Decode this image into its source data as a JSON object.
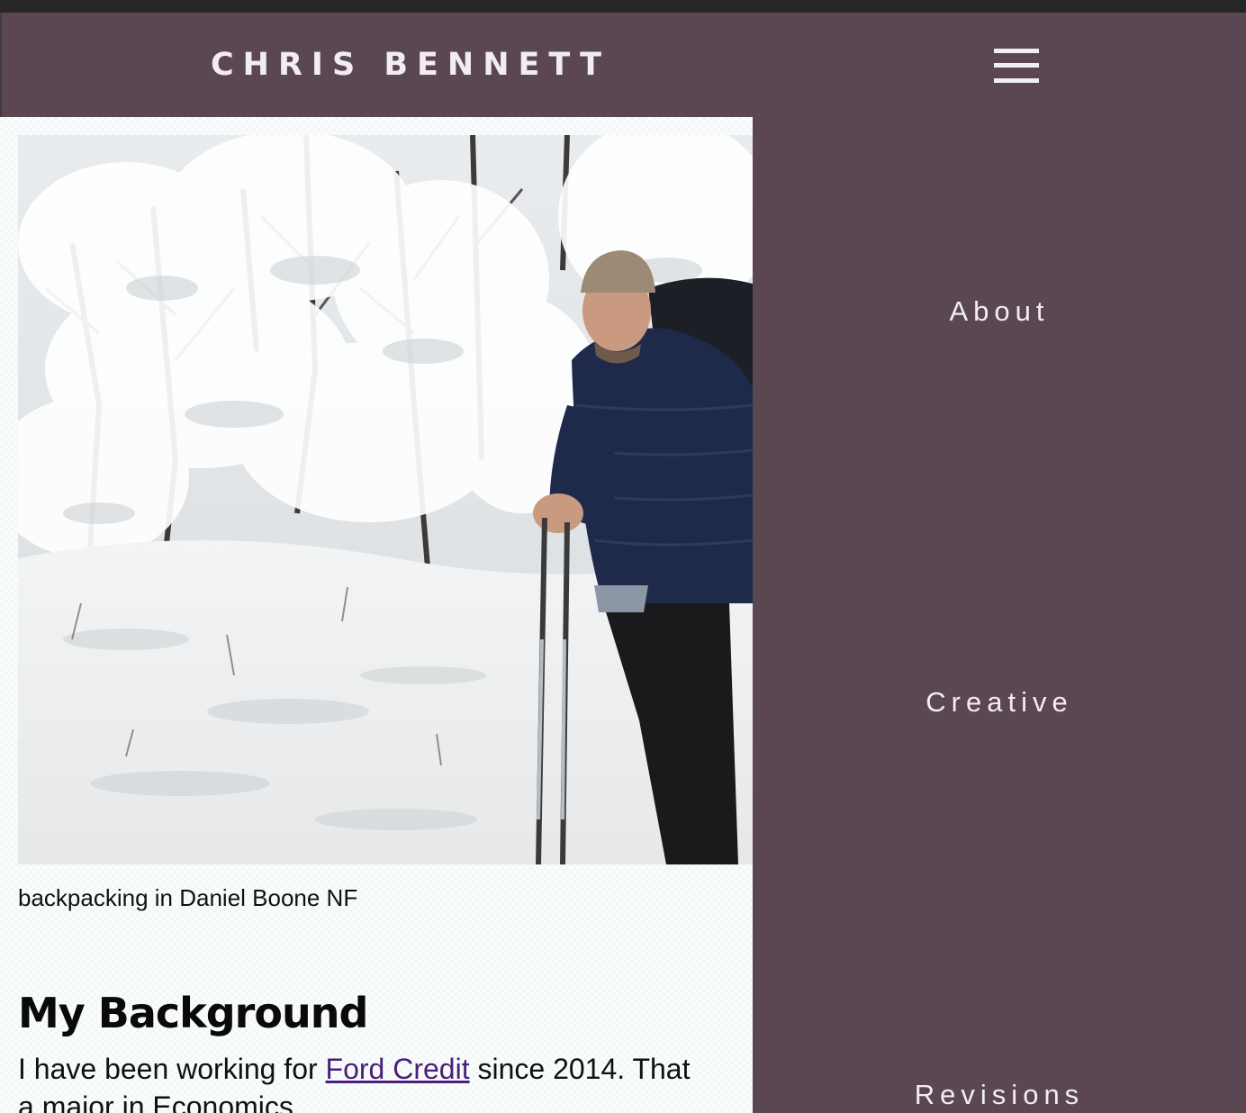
{
  "header": {
    "site_title": "CHRIS BENNETT",
    "menu_icon": "hamburger-menu-icon"
  },
  "photo": {
    "caption": "backpacking in Daniel Boone NF"
  },
  "section": {
    "heading": "My Background",
    "text_before_link": "I have been working for ",
    "link_text": "Ford Credit",
    "text_after_link": " since 2014. That",
    "text_line2": "a major in Economics"
  },
  "nav_menu": {
    "items": [
      {
        "label": "About"
      },
      {
        "label": "Creative"
      },
      {
        "label": "Revisions"
      }
    ]
  },
  "colors": {
    "menu_background": "#5a4751",
    "menu_text": "#f1edf0",
    "link": "#4b1f7a"
  }
}
